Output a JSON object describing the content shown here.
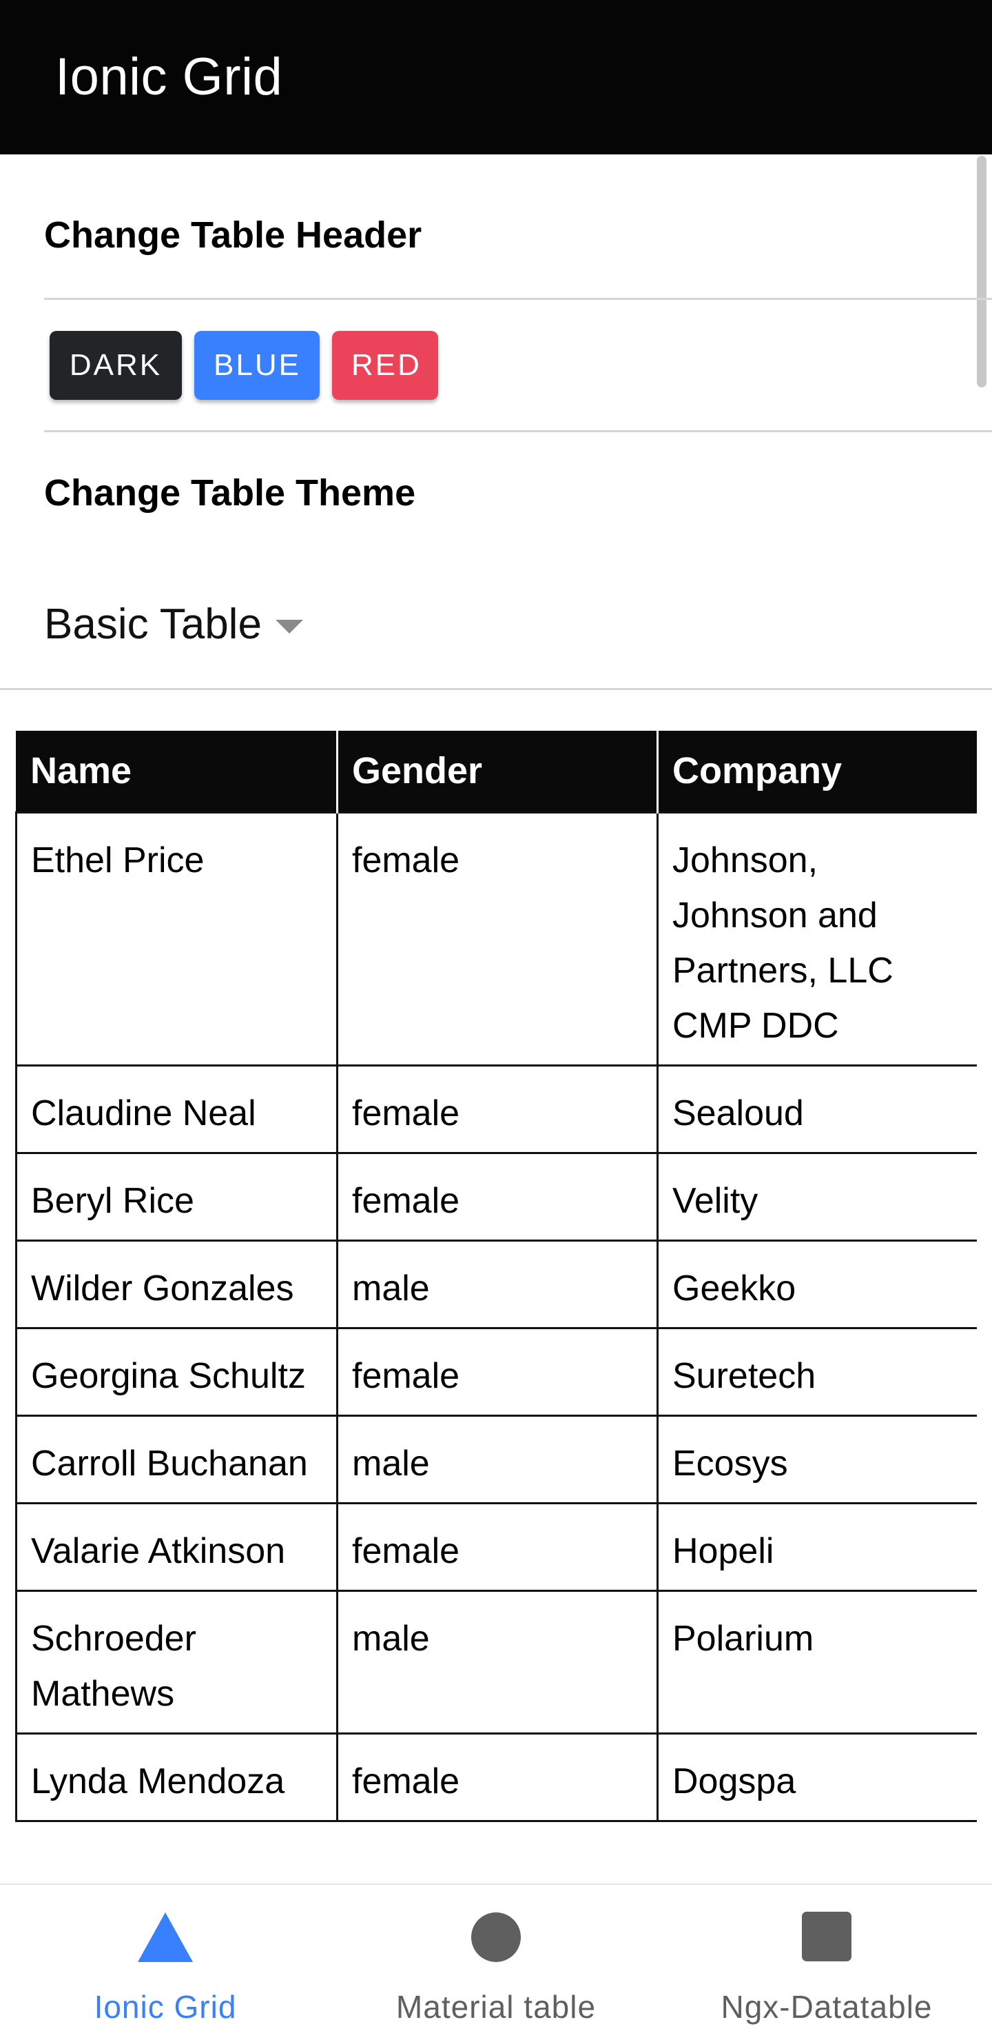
{
  "toolbar": {
    "title": "Ionic Grid"
  },
  "settings": {
    "header_label": "Change Table Header",
    "theme_label": "Change Table Theme",
    "buttons": {
      "dark": "DARK",
      "blue": "BLUE",
      "red": "RED"
    },
    "theme_select": {
      "value": "Basic Table"
    }
  },
  "table": {
    "headers": [
      "Name",
      "Gender",
      "Company"
    ],
    "rows": [
      [
        "Ethel Price",
        "female",
        "Johnson, Johnson and Partners, LLC CMP DDC"
      ],
      [
        "Claudine Neal",
        "female",
        "Sealoud"
      ],
      [
        "Beryl Rice",
        "female",
        "Velity"
      ],
      [
        "Wilder Gonzales",
        "male",
        "Geekko"
      ],
      [
        "Georgina Schultz",
        "female",
        "Suretech"
      ],
      [
        "Carroll Buchanan",
        "male",
        "Ecosys"
      ],
      [
        "Valarie Atkinson",
        "female",
        "Hopeli"
      ],
      [
        "Schroeder Mathews",
        "male",
        "Polarium"
      ],
      [
        "Lynda Mendoza",
        "female",
        "Dogspa"
      ]
    ]
  },
  "tabs": [
    {
      "label": "Ionic Grid",
      "icon": "triangle-icon",
      "active": true
    },
    {
      "label": "Material table",
      "icon": "circle-icon",
      "active": false
    },
    {
      "label": "Ngx-Datatable",
      "icon": "square-icon",
      "active": false
    }
  ],
  "colors": {
    "toolbar_bg": "#050505",
    "dark": "#222428",
    "primary": "#3880ff",
    "danger": "#eb445a",
    "tab_inactive": "#5f5f5f"
  }
}
